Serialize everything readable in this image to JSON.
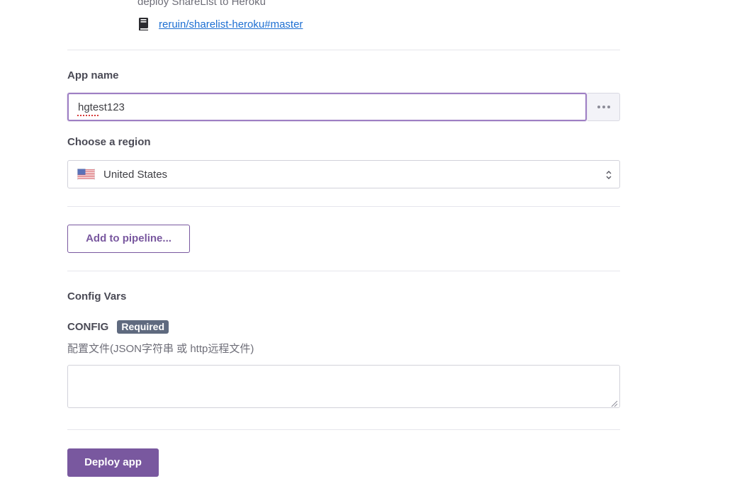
{
  "app": {
    "description": "deploy ShareList to Heroku",
    "repo_link": "reruin/sharelist-heroku#master"
  },
  "app_name": {
    "label": "App name",
    "value": "hgtest123",
    "more_icon": "ellipsis-icon"
  },
  "region": {
    "label": "Choose a region",
    "selected": "United States",
    "flag_icon": "us-flag-icon",
    "chevron_icon": "updown-chevron-icon"
  },
  "pipeline": {
    "button_label": "Add to pipeline..."
  },
  "config_vars": {
    "heading": "Config Vars",
    "name": "CONFIG",
    "badge": "Required",
    "description": "配置文件(JSON字符串 或 http远程文件)",
    "value": ""
  },
  "deploy": {
    "button_label": "Deploy app"
  },
  "colors": {
    "accent": "#79589f",
    "link": "#1d6fd2",
    "badge": "#5f6a7f",
    "focus_border": "#9e7fc4"
  }
}
